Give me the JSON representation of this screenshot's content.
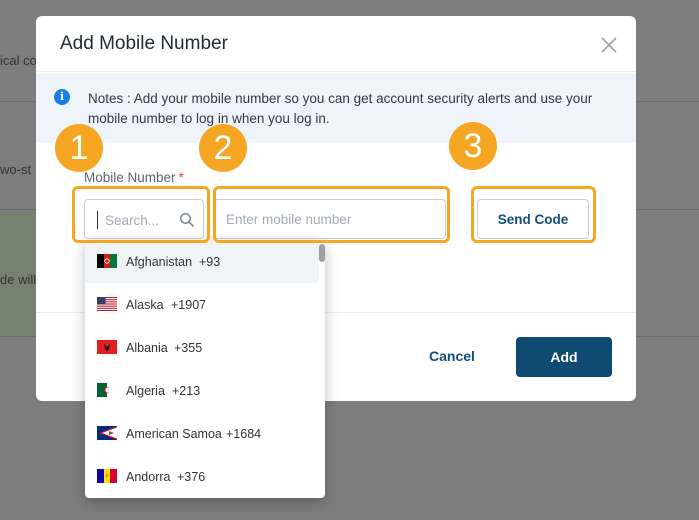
{
  "background": {
    "row1_text": "ical co",
    "row2_text": "wo-st",
    "row3_text": "de will"
  },
  "modal": {
    "title": "Add Mobile Number",
    "note": "Notes : Add your mobile number so you can get account security alerts and use your mobile number to log in when you log in.",
    "field_label": "Mobile Number",
    "required_mark": "*",
    "search_placeholder": "Search...",
    "phone_placeholder": "Enter mobile number",
    "send_code_label": "Send Code",
    "cancel_label": "Cancel",
    "add_label": "Add"
  },
  "countries": [
    {
      "name": "Afghanistan",
      "code": "+93",
      "flag": "flag-afghanistan-icon"
    },
    {
      "name": "Alaska",
      "code": "+1907",
      "flag": "flag-us-icon"
    },
    {
      "name": "Albania",
      "code": "+355",
      "flag": "flag-albania-icon"
    },
    {
      "name": "Algeria",
      "code": "+213",
      "flag": "flag-algeria-icon"
    },
    {
      "name": "American Samoa",
      "code": "+1684",
      "flag": "flag-american-samoa-icon"
    },
    {
      "name": "Andorra",
      "code": "+376",
      "flag": "flag-andorra-icon"
    }
  ],
  "annotations": [
    "1",
    "2",
    "3"
  ],
  "colors": {
    "accent": "#0f4a73",
    "highlight": "#f5a623",
    "info": "#1a7de0"
  }
}
